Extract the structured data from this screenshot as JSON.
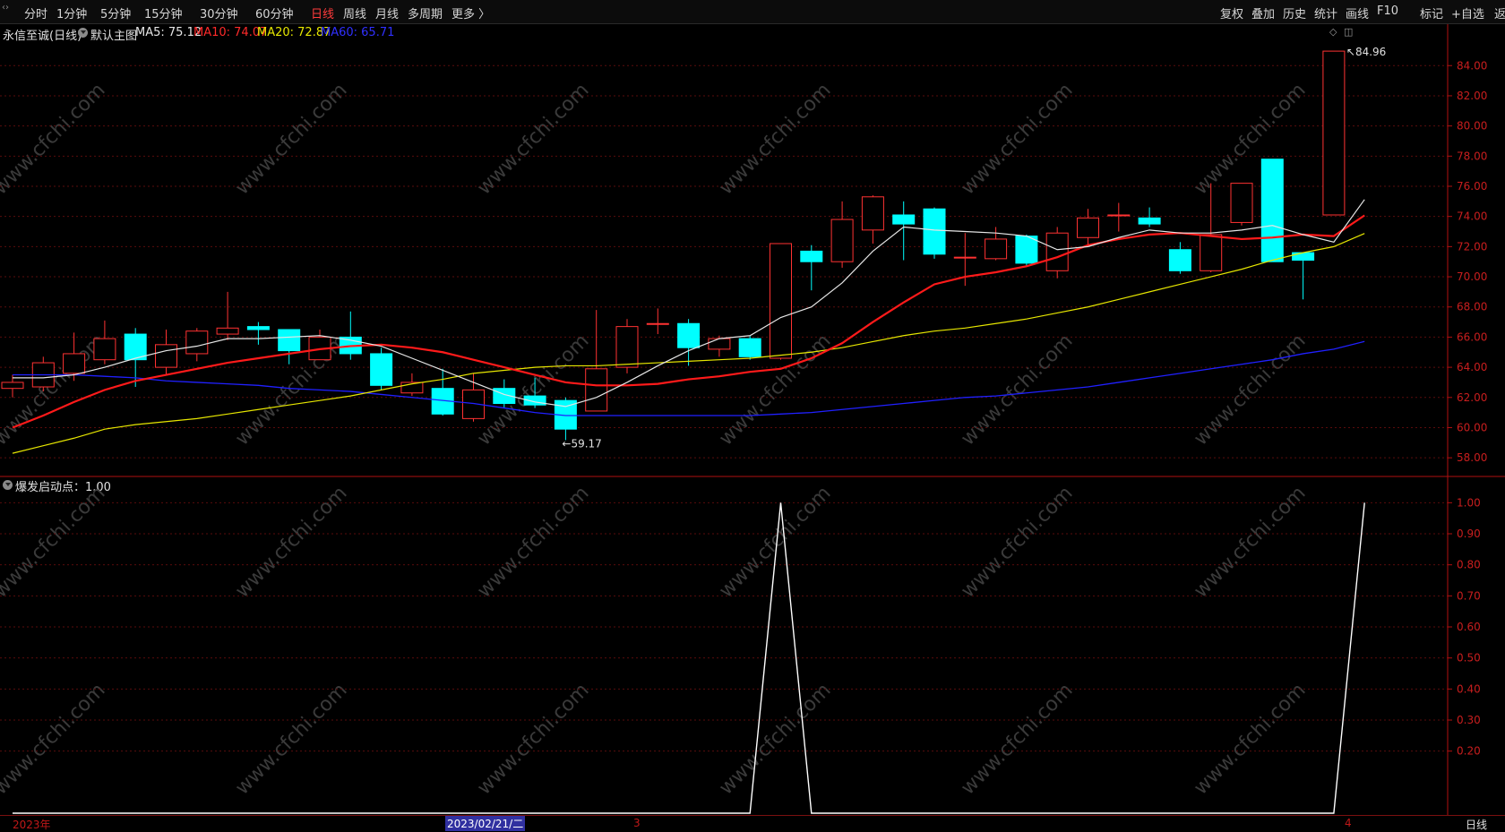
{
  "toolbar": {
    "periods": [
      "分时",
      "1分钟",
      "5分钟",
      "15分钟",
      "30分钟",
      "60分钟",
      "日线",
      "周线",
      "月线",
      "多周期",
      "更多 〉"
    ],
    "active_period": "日线",
    "right_buttons": [
      "复权",
      "叠加",
      "历史",
      "统计",
      "画线",
      "F10",
      "+自选",
      "返回"
    ],
    "mark_button": "标记"
  },
  "main_title": {
    "stock": "永信至诚(日线)",
    "template": "默认主图",
    "ma5": "MA5: 75.12",
    "ma10": "MA10: 74.07",
    "ma20": "MA20: 72.87",
    "ma60": "MA60: 65.71"
  },
  "indicator_title": "爆发启动点：1.00",
  "annotations": {
    "high": "84.96",
    "low": "59.17"
  },
  "bottom": {
    "year_label": "2023年",
    "cursor_date": "2023/02/21/二",
    "month_3": "3",
    "month_4": "4",
    "period_label": "日线"
  },
  "watermark": "www.cfchi.com",
  "colors": {
    "up": "#ff3232",
    "down": "#00ffff",
    "ma5": "#e6e6e6",
    "ma10": "#ff1a1a",
    "ma20": "#e6e600",
    "ma60": "#2020ff",
    "axis": "#b01010"
  },
  "chart_data": [
    {
      "type": "candlestick",
      "ylim": [
        57,
        85.5
      ],
      "yticks": [
        "58.00",
        "60.00",
        "62.00",
        "64.00",
        "66.00",
        "68.00",
        "70.00",
        "72.00",
        "74.00",
        "76.00",
        "78.00",
        "80.00",
        "82.00",
        "84.00"
      ],
      "candles": [
        {
          "o": 62.6,
          "c": 63.0,
          "h": 63.5,
          "l": 62.0
        },
        {
          "o": 62.7,
          "c": 64.3,
          "h": 64.7,
          "l": 62.4
        },
        {
          "o": 63.6,
          "c": 64.9,
          "h": 66.3,
          "l": 63.1
        },
        {
          "o": 64.5,
          "c": 65.9,
          "h": 67.1,
          "l": 64.2
        },
        {
          "o": 66.2,
          "c": 64.5,
          "h": 66.6,
          "l": 62.7
        },
        {
          "o": 64.0,
          "c": 65.5,
          "h": 66.5,
          "l": 63.5
        },
        {
          "o": 64.9,
          "c": 66.4,
          "h": 66.6,
          "l": 64.4
        },
        {
          "o": 66.2,
          "c": 66.6,
          "h": 69.0,
          "l": 65.8
        },
        {
          "o": 66.7,
          "c": 66.5,
          "h": 67.0,
          "l": 65.5
        },
        {
          "o": 66.5,
          "c": 65.1,
          "h": 66.5,
          "l": 64.2
        },
        {
          "o": 64.5,
          "c": 66.0,
          "h": 66.5,
          "l": 64.5
        },
        {
          "o": 66.0,
          "c": 64.9,
          "h": 67.7,
          "l": 64.5
        },
        {
          "o": 64.9,
          "c": 62.8,
          "h": 65.3,
          "l": 62.5
        },
        {
          "o": 62.3,
          "c": 63.0,
          "h": 63.6,
          "l": 62.1
        },
        {
          "o": 62.6,
          "c": 60.9,
          "h": 63.9,
          "l": 60.8
        },
        {
          "o": 60.6,
          "c": 62.5,
          "h": 63.6,
          "l": 60.4
        },
        {
          "o": 62.6,
          "c": 61.6,
          "h": 63.2,
          "l": 61.3
        },
        {
          "o": 62.1,
          "c": 61.5,
          "h": 63.3,
          "l": 61.3
        },
        {
          "o": 61.8,
          "c": 59.9,
          "h": 62.0,
          "l": 59.17
        },
        {
          "o": 61.1,
          "c": 63.9,
          "h": 67.8,
          "l": 61.1
        },
        {
          "o": 64.0,
          "c": 66.7,
          "h": 67.2,
          "l": 63.6
        },
        {
          "o": 66.9,
          "c": 66.9,
          "h": 67.9,
          "l": 66.2
        },
        {
          "o": 66.9,
          "c": 65.3,
          "h": 67.2,
          "l": 64.1
        },
        {
          "o": 65.2,
          "c": 65.9,
          "h": 66.1,
          "l": 64.7
        },
        {
          "o": 65.9,
          "c": 64.7,
          "h": 66.1,
          "l": 64.5
        },
        {
          "o": 64.6,
          "c": 72.2,
          "h": 72.2,
          "l": 64.5
        },
        {
          "o": 71.7,
          "c": 71.0,
          "h": 72.1,
          "l": 69.1
        },
        {
          "o": 71.0,
          "c": 73.8,
          "h": 75.0,
          "l": 70.6
        },
        {
          "o": 73.1,
          "c": 75.3,
          "h": 75.4,
          "l": 72.2
        },
        {
          "o": 74.1,
          "c": 73.5,
          "h": 75.0,
          "l": 71.1
        },
        {
          "o": 74.5,
          "c": 71.5,
          "h": 74.6,
          "l": 71.2
        },
        {
          "o": 71.3,
          "c": 71.3,
          "h": 72.9,
          "l": 69.4
        },
        {
          "o": 71.2,
          "c": 72.5,
          "h": 73.3,
          "l": 71.1
        },
        {
          "o": 72.7,
          "c": 70.9,
          "h": 72.8,
          "l": 70.7
        },
        {
          "o": 70.4,
          "c": 72.9,
          "h": 73.3,
          "l": 69.9
        },
        {
          "o": 72.6,
          "c": 73.9,
          "h": 74.5,
          "l": 72.1
        },
        {
          "o": 74.1,
          "c": 74.1,
          "h": 74.9,
          "l": 73.0
        },
        {
          "o": 73.9,
          "c": 73.5,
          "h": 74.6,
          "l": 73.3
        },
        {
          "o": 71.8,
          "c": 70.4,
          "h": 72.3,
          "l": 70.2
        },
        {
          "o": 70.4,
          "c": 72.8,
          "h": 76.2,
          "l": 70.3
        },
        {
          "o": 73.6,
          "c": 76.2,
          "h": 76.2,
          "l": 73.4
        },
        {
          "o": 77.8,
          "c": 71.0,
          "h": 77.8,
          "l": 71.0
        },
        {
          "o": 71.6,
          "c": 71.1,
          "h": 71.6,
          "l": 68.5
        },
        {
          "o": 74.1,
          "c": 84.96,
          "h": 84.96,
          "l": 74.1
        }
      ],
      "ma5": [
        63.3,
        63.3,
        63.5,
        64.0,
        64.6,
        65.1,
        65.4,
        65.9,
        65.9,
        66.0,
        66.1,
        65.8,
        65.4,
        64.6,
        63.8,
        63.0,
        62.2,
        61.7,
        61.4,
        62.0,
        63.0,
        64.1,
        65.1,
        65.9,
        66.1,
        67.3,
        68.0,
        69.6,
        71.7,
        73.3,
        73.1,
        73.0,
        72.9,
        72.7,
        71.8,
        72.0,
        72.6,
        73.1,
        72.9,
        72.9,
        73.1,
        73.4,
        72.8,
        72.3,
        75.12
      ],
      "ma10": [
        60.0,
        60.8,
        61.7,
        62.5,
        63.1,
        63.5,
        63.9,
        64.3,
        64.6,
        64.9,
        65.2,
        65.4,
        65.5,
        65.3,
        65.0,
        64.5,
        64.0,
        63.5,
        63.0,
        62.8,
        62.8,
        62.9,
        63.2,
        63.4,
        63.7,
        63.9,
        64.6,
        65.6,
        67.0,
        68.3,
        69.5,
        70.0,
        70.3,
        70.7,
        71.3,
        72.1,
        72.5,
        72.8,
        72.9,
        72.7,
        72.5,
        72.6,
        72.8,
        72.7,
        74.07
      ],
      "ma20": [
        58.3,
        58.8,
        59.3,
        59.9,
        60.2,
        60.4,
        60.6,
        60.9,
        61.2,
        61.5,
        61.8,
        62.1,
        62.5,
        62.9,
        63.2,
        63.6,
        63.8,
        64.0,
        64.1,
        64.1,
        64.2,
        64.3,
        64.4,
        64.5,
        64.6,
        64.8,
        65.0,
        65.3,
        65.7,
        66.1,
        66.4,
        66.6,
        66.9,
        67.2,
        67.6,
        68.0,
        68.5,
        69.0,
        69.5,
        70.0,
        70.5,
        71.1,
        71.6,
        72.0,
        72.87
      ],
      "ma60": [
        63.5,
        63.5,
        63.5,
        63.4,
        63.3,
        63.1,
        63.0,
        62.9,
        62.8,
        62.6,
        62.5,
        62.4,
        62.2,
        62.0,
        61.8,
        61.6,
        61.3,
        61.0,
        60.8,
        60.8,
        60.8,
        60.8,
        60.8,
        60.8,
        60.8,
        60.9,
        61.0,
        61.2,
        61.4,
        61.6,
        61.8,
        62.0,
        62.1,
        62.3,
        62.5,
        62.7,
        63.0,
        63.3,
        63.6,
        63.9,
        64.2,
        64.5,
        64.9,
        65.2,
        65.71
      ]
    },
    {
      "type": "line",
      "title": "爆发启动点：1.00",
      "ylim": [
        0,
        1.05
      ],
      "yticks": [
        "0.20",
        "0.30",
        "0.40",
        "0.50",
        "0.60",
        "0.70",
        "0.80",
        "0.90",
        "1.00"
      ],
      "values": [
        0,
        0,
        0,
        0,
        0,
        0,
        0,
        0,
        0,
        0,
        0,
        0,
        0,
        0,
        0,
        0,
        0,
        0,
        0,
        0,
        0,
        0,
        0,
        0,
        0,
        1,
        0,
        0,
        0,
        0,
        0,
        0,
        0,
        0,
        0,
        0,
        0,
        0,
        0,
        0,
        0,
        0,
        0,
        0,
        1
      ]
    }
  ]
}
